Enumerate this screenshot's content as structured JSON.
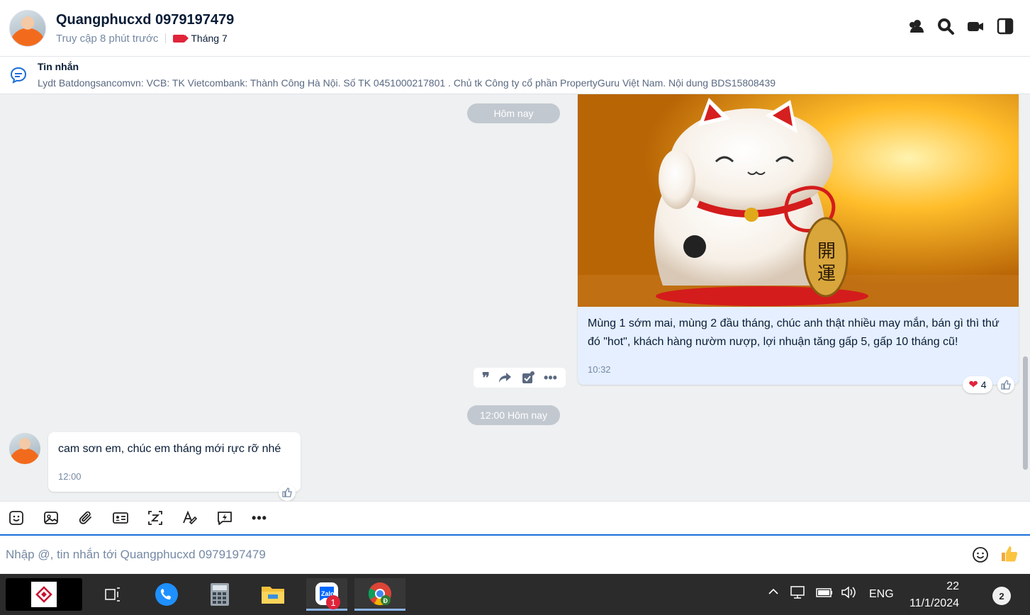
{
  "header": {
    "name": "Quangphucxd 0979197479",
    "last_seen": "Truy cập 8 phút trước",
    "tag_label": "Tháng 7"
  },
  "pinned": {
    "title": "Tin nhắn",
    "text": "Lydt Batdongsancomvn: VCB: TK Vietcombank: Thành Công Hà Nội. Số TK 0451000217801 . Chủ tk Công ty cổ phần PropertyGuru Việt Nam. Nội dung BDS15808439"
  },
  "chat": {
    "date_divider_1": "Hôm nay",
    "sent_message": {
      "text": "Mùng 1 sớm mai, mùng 2 đầu tháng, chúc anh thật nhiều may mắn, bán gì thì thứ đó \"hot\", khách hàng nườm nượp, lợi nhuận tăng gấp 5, gấp 10 tháng cũ!",
      "time": "10:32",
      "reaction_count": "4"
    },
    "date_divider_2": "12:00 Hôm nay",
    "received_message": {
      "text": "cam sơn em, chúc em tháng mới rực rỡ nhé",
      "time": "12:00"
    }
  },
  "composer": {
    "placeholder": "Nhập @, tin nhắn tới Quangphucxd 0979197479"
  },
  "taskbar": {
    "zalo_badge": "1",
    "language": "ENG",
    "time": "22",
    "date": "11/1/2024",
    "notifications": "2"
  },
  "colors": {
    "accent": "#1a6edb",
    "sent_bubble": "#e5efff",
    "tag": "#e0243a"
  }
}
